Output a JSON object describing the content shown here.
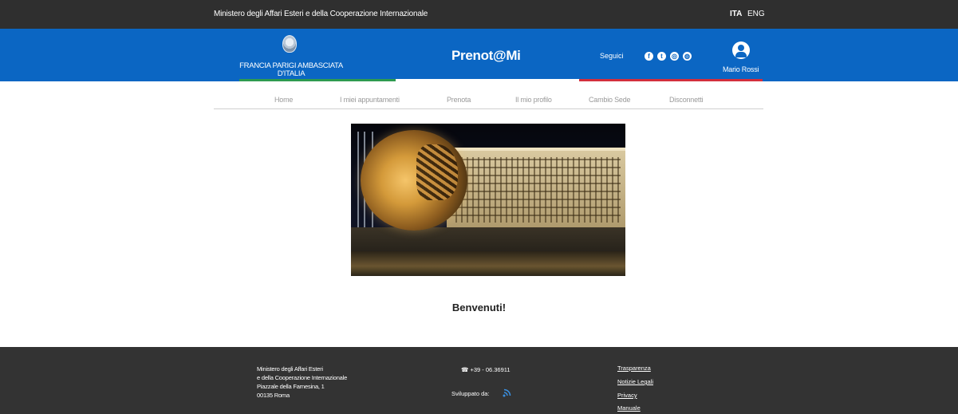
{
  "topbar": {
    "ministry": "Ministero degli Affari Esteri e della Cooperazione Internazionale",
    "lang_ita": "ITA",
    "lang_eng": "ENG"
  },
  "header": {
    "embassy_name": "FRANCIA PARIGI AMBASCIATA D'ITALIA",
    "brand": "Prenot@Mi",
    "follow_label": "Seguici",
    "social_icons": [
      "facebook-icon",
      "twitter-icon",
      "instagram-icon",
      "globe-icon"
    ],
    "username": "Mario Rossi",
    "colors": {
      "blue": "#0b66c3",
      "green": "#2e9b4f",
      "red": "#d32f3c"
    }
  },
  "nav": {
    "items": [
      {
        "label": "Home"
      },
      {
        "label": "I miei appuntamenti"
      },
      {
        "label": "Prenota"
      },
      {
        "label": "Il mio profilo"
      },
      {
        "label": "Cambio Sede"
      },
      {
        "label": "Disconnetti"
      }
    ]
  },
  "main": {
    "welcome": "Benvenuti!"
  },
  "footer": {
    "address": [
      "Ministero degli Affari Esteri",
      "e della Cooperazione Internazionale",
      "Piazzale della Farnesina, 1",
      "00135 Roma"
    ],
    "phone": "+39 - 06.36911",
    "developed_by": "Sviluppato da:",
    "links": [
      "Trasparenza",
      "Notizie Legali",
      "Privacy",
      "Manuale"
    ]
  }
}
